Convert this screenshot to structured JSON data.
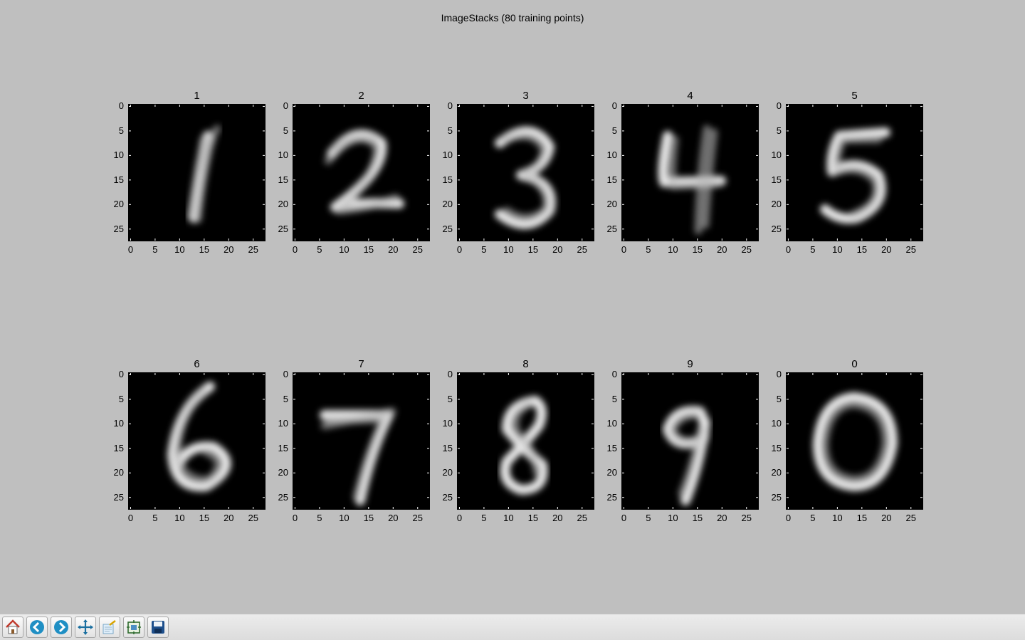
{
  "title": "ImageStacks (80 training points)",
  "chart_data": {
    "type": "heatmap",
    "colormap": "gray",
    "layout": "2 rows x 5 columns",
    "image_size": [
      28,
      28
    ],
    "title": "ImageStacks (80 training points)",
    "x_ticks": [
      "0",
      "5",
      "10",
      "15",
      "20",
      "25"
    ],
    "y_ticks": [
      "0",
      "5",
      "10",
      "15",
      "20",
      "25"
    ],
    "xlim": [
      -0.5,
      27.5
    ],
    "ylim": [
      27.5,
      -0.5
    ],
    "panels": [
      {
        "title": "1",
        "digit": "1",
        "description": "average image of handwritten digit 1"
      },
      {
        "title": "2",
        "digit": "2",
        "description": "average image of handwritten digit 2"
      },
      {
        "title": "3",
        "digit": "3",
        "description": "average image of handwritten digit 3"
      },
      {
        "title": "4",
        "digit": "4",
        "description": "average image of handwritten digit 4"
      },
      {
        "title": "5",
        "digit": "5",
        "description": "average image of handwritten digit 5"
      },
      {
        "title": "6",
        "digit": "6",
        "description": "average image of handwritten digit 6"
      },
      {
        "title": "7",
        "digit": "7",
        "description": "average image of handwritten digit 7"
      },
      {
        "title": "8",
        "digit": "8",
        "description": "average image of handwritten digit 8"
      },
      {
        "title": "9",
        "digit": "9",
        "description": "average image of handwritten digit 9"
      },
      {
        "title": "0",
        "digit": "0",
        "description": "average image of handwritten digit 0"
      }
    ]
  },
  "toolbar": {
    "buttons": [
      {
        "icon": "home-icon"
      },
      {
        "icon": "back-arrow-icon"
      },
      {
        "icon": "forward-arrow-icon"
      },
      {
        "icon": "pan-icon"
      },
      {
        "icon": "zoom-icon"
      },
      {
        "icon": "subplots-icon"
      },
      {
        "icon": "save-icon"
      }
    ]
  }
}
